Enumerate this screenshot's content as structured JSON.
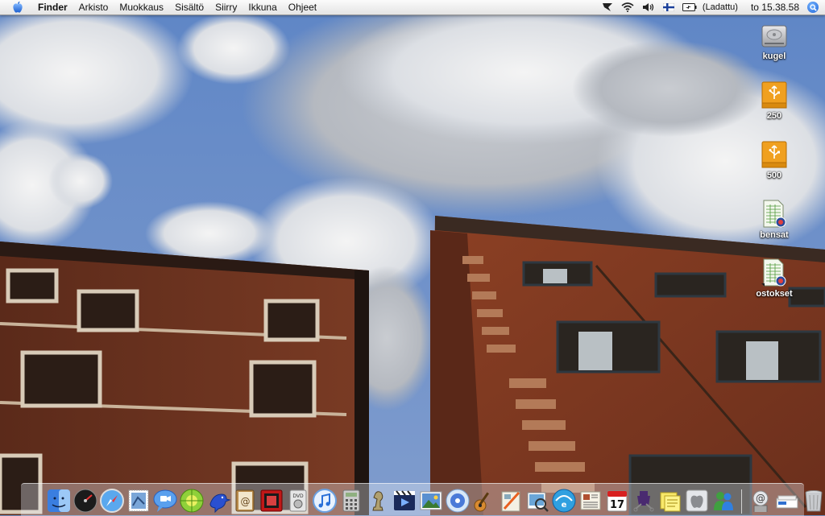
{
  "menubar": {
    "app_name": "Finder",
    "menus": [
      "Arkisto",
      "Muokkaus",
      "Sisältö",
      "Siirry",
      "Ikkuna",
      "Ohjeet"
    ],
    "battery_status": "(Ladattu)",
    "clock": "to 15.38.58"
  },
  "desktop_icons": [
    {
      "label": "kugel",
      "icon": "hard-drive-icon"
    },
    {
      "label": "250",
      "icon": "usb-drive-icon"
    },
    {
      "label": "500",
      "icon": "usb-drive-icon"
    },
    {
      "label": "bensat",
      "icon": "spreadsheet-document-icon"
    },
    {
      "label": "ostokset",
      "icon": "spreadsheet-document-icon"
    }
  ],
  "dock": {
    "apps": [
      "finder-icon",
      "dashboard-icon",
      "safari-icon",
      "mail-stamp-icon",
      "ichat-icon",
      "network-icon",
      "bird-icon",
      "address-book-icon",
      "photo-booth-icon",
      "dvd-player-icon",
      "itunes-icon",
      "calculator-icon",
      "chess-icon",
      "imovie-icon",
      "iphoto-icon",
      "idvd-icon",
      "garageband-icon",
      "iweb-icon",
      "preview-icon",
      "ical-icon",
      "newspaper-icon",
      "calendar-icon",
      "script-editor-icon",
      "stickies-icon",
      "apple-icon",
      "messenger-icon"
    ],
    "calendar_day": "17",
    "trailing": [
      "mail-at-icon",
      "documents-folder-icon",
      "trash-icon"
    ]
  },
  "colors": {
    "sky_blue": "#6f8fc0",
    "building_brick": "#8a3f24",
    "usb_orange": "#f0a020"
  }
}
